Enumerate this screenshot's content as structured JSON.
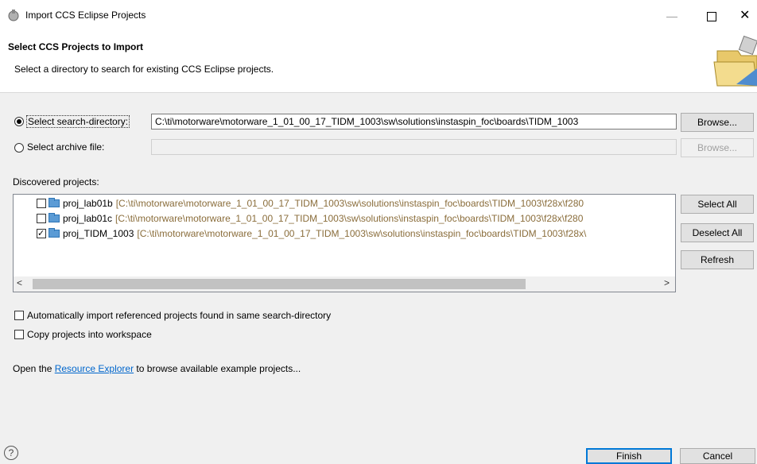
{
  "window": {
    "title": "Import CCS Eclipse Projects",
    "minimize_glyph": "—",
    "close_glyph": "✕"
  },
  "header": {
    "title": "Select CCS Projects to Import",
    "description": "Select a directory to search for existing CCS Eclipse projects."
  },
  "search_directory": {
    "label": "Select search-directory:",
    "selected": true,
    "value": "C:\\ti\\motorware\\motorware_1_01_00_17_TIDM_1003\\sw\\solutions\\instaspin_foc\\boards\\TIDM_1003",
    "browse_label": "Browse..."
  },
  "archive_file": {
    "label": "Select archive file:",
    "selected": false,
    "value": "",
    "browse_label": "Browse..."
  },
  "discovered": {
    "label": "Discovered projects:",
    "projects": [
      {
        "name": "proj_lab01b",
        "path": "[C:\\ti\\motorware\\motorware_1_01_00_17_TIDM_1003\\sw\\solutions\\instaspin_foc\\boards\\TIDM_1003\\f28x\\f280",
        "checked": false
      },
      {
        "name": "proj_lab01c",
        "path": "[C:\\ti\\motorware\\motorware_1_01_00_17_TIDM_1003\\sw\\solutions\\instaspin_foc\\boards\\TIDM_1003\\f28x\\f280",
        "checked": false
      },
      {
        "name": "proj_TIDM_1003",
        "path": "[C:\\ti\\motorware\\motorware_1_01_00_17_TIDM_1003\\sw\\solutions\\instaspin_foc\\boards\\TIDM_1003\\f28x\\",
        "checked": true
      }
    ],
    "select_all_label": "Select All",
    "deselect_all_label": "Deselect All",
    "refresh_label": "Refresh",
    "scroll_left_glyph": "<",
    "scroll_right_glyph": ">"
  },
  "options": {
    "auto_import_label": "Automatically import referenced projects found in same search-directory",
    "auto_import_checked": false,
    "copy_label": "Copy projects into workspace",
    "copy_checked": false
  },
  "resource_explorer": {
    "prefix": "Open the ",
    "link": "Resource Explorer",
    "suffix": " to browse available example projects..."
  },
  "footer": {
    "help_glyph": "?",
    "finish_label": "Finish",
    "cancel_label": "Cancel"
  },
  "colors": {
    "link": "#0066cc",
    "path_text": "#8a6d3b",
    "primary_border": "#0078d7",
    "folder": "#5b9bd5"
  }
}
